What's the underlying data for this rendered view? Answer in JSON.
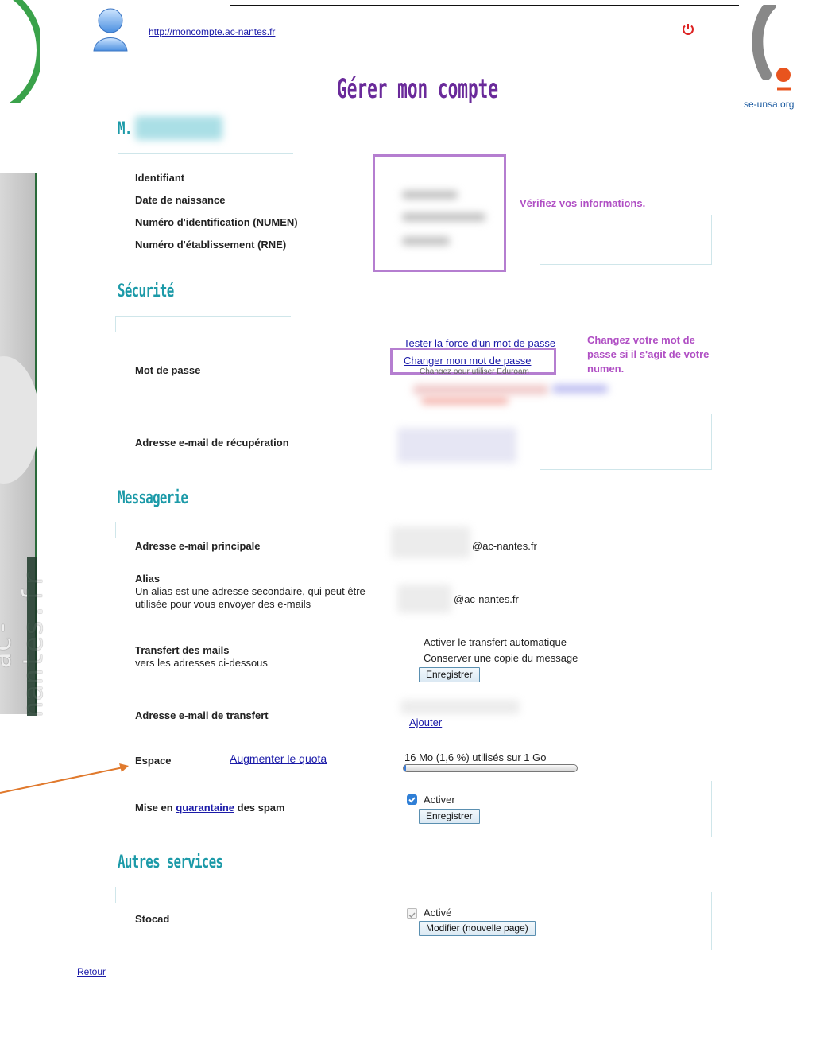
{
  "header": {
    "url": "http://moncompte.ac-nantes.fr",
    "title": "Gérer mon compte",
    "logo_text": "se-unsa.org",
    "sidebar_text": "ac-nantes.fr"
  },
  "user": {
    "prefix": "M."
  },
  "identity": {
    "labels": [
      "Identifiant",
      "Date de naissance",
      "Numéro d'identification (NUMEN)",
      "Numéro d'établissement (RNE)"
    ],
    "annotation": "Vérifiez vos informations."
  },
  "security": {
    "title": "Sécurité",
    "password_label": "Mot de passe",
    "test_strength_link": "Tester la force d'un mot de passe",
    "change_password_link": "Changer mon mot de passe",
    "eduroam_hint": "Changez pour utiliser Eduroam",
    "recovery_email_label": "Adresse e-mail de récupération",
    "annotation": "Changez votre mot de passe si il s'agit de votre numen."
  },
  "messaging": {
    "title": "Messagerie",
    "main_email_label": "Adresse e-mail principale",
    "main_email_domain": "@ac-nantes.fr",
    "alias_label": "Alias",
    "alias_desc": "Un alias est une adresse secondaire, qui peut être utilisée pour vous envoyer des e-mails",
    "alias_domain": "@ac-nantes.fr",
    "transfer_label": "Transfert des mails",
    "transfer_desc": "vers les adresses ci-dessous",
    "transfer_auto": "Activer le transfert automatique",
    "transfer_keep_copy": "Conserver une copie du message",
    "save_button": "Enregistrer",
    "transfer_email_label": "Adresse e-mail de transfert",
    "add_link": "Ajouter",
    "space_label": "Espace",
    "quota_link": "Augmenter le quota",
    "usage_text": "16 Mo (1,6 %) utilisés sur 1 Go",
    "usage_fraction": 0.016,
    "spam_label_prefix": "Mise en",
    "spam_label_link": "quarantaine",
    "spam_label_suffix": "des spam",
    "spam_activate": "Activer",
    "spam_checked": true,
    "spam_save_button": "Enregistrer"
  },
  "other": {
    "title": "Autres services",
    "stocad_label": "Stocad",
    "stocad_status": "Activé",
    "modify_button": "Modifier (nouvelle page)"
  },
  "footer": {
    "back_link": "Retour"
  },
  "colors": {
    "section": "#1c9aa8",
    "annotation": "#b04fc4",
    "title": "#6a2a9a",
    "arrow": "#e07a2e",
    "logo_dot": "#e8541e"
  }
}
